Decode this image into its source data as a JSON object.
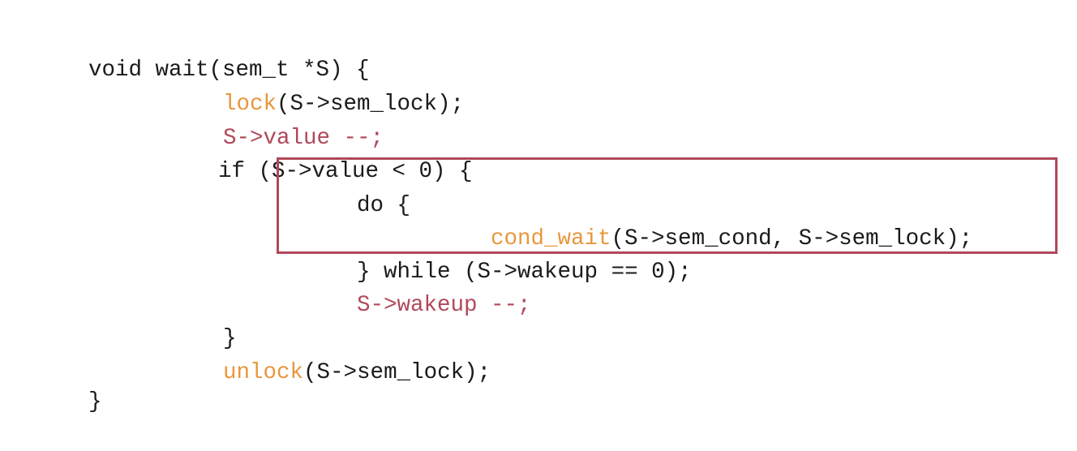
{
  "code": {
    "line1": {
      "text": "void wait(sem_t *S) {"
    },
    "line2": {
      "func": "lock",
      "rest": "(S->sem_lock);"
    },
    "line3": {
      "text": "S->value --;"
    },
    "line4": {
      "text": "if (S->value < 0) {"
    },
    "line5": {
      "text": "do {"
    },
    "line6": {
      "func": "cond_wait",
      "rest": "(S->sem_cond, S->sem_lock);"
    },
    "line7": {
      "text": "} while (S->wakeup == 0);"
    },
    "line8": {
      "text": "S->wakeup --;"
    },
    "line9": {
      "text": "}"
    },
    "line10": {
      "func": "unlock",
      "rest": "(S->sem_lock);"
    },
    "line11": {
      "text": "}"
    }
  },
  "colors": {
    "function_call": "#e8973c",
    "decrement_statement": "#b0485a",
    "highlight_border": "#b0485a",
    "default_text": "#1a1a1a"
  }
}
